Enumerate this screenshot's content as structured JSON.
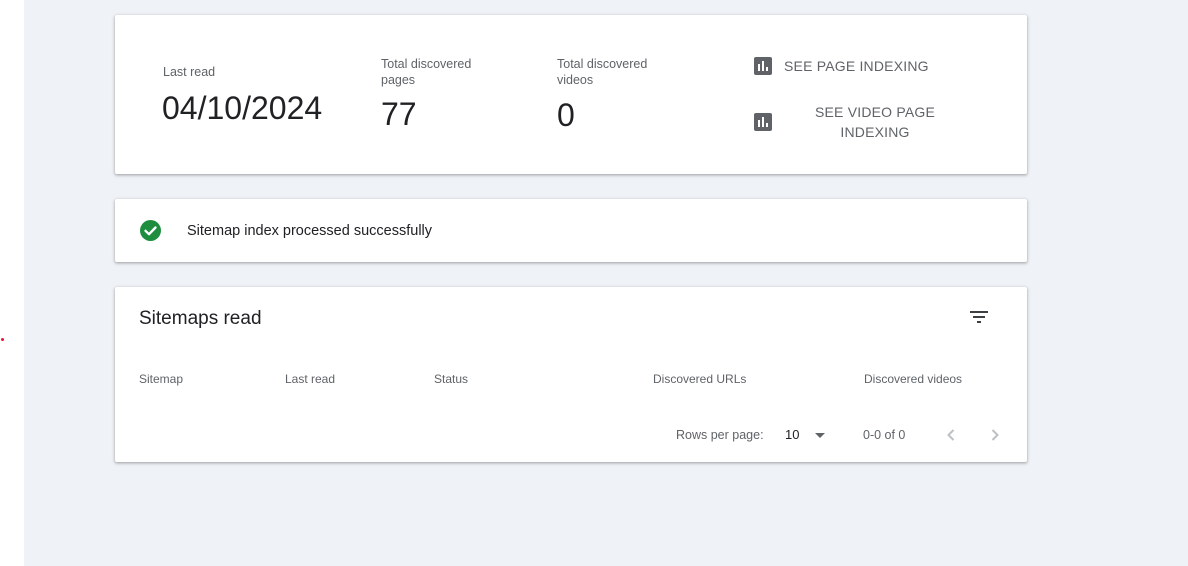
{
  "summary": {
    "last_read_label": "Last read",
    "last_read_value": "04/10/2024",
    "pages_label_line1": "Total discovered",
    "pages_label_line2": "pages",
    "pages_value": "77",
    "videos_label_line1": "Total discovered",
    "videos_label_line2": "videos",
    "videos_value": "0",
    "see_page_indexing": "SEE PAGE INDEXING",
    "see_video_indexing_line1": "SEE VIDEO PAGE",
    "see_video_indexing_line2": "INDEXING",
    "icon": "bar-chart-icon"
  },
  "status": {
    "text": "Sitemap index processed successfully",
    "icon": "check-circle-icon",
    "color": "#1e8e3e"
  },
  "table": {
    "title": "Sitemaps read",
    "filter_icon": "filter-icon",
    "columns": [
      "Sitemap",
      "Last read",
      "Status",
      "Discovered URLs",
      "Discovered videos"
    ],
    "rows": [],
    "pagination": {
      "rows_per_page_label": "Rows per page:",
      "rows_per_page_value": "10",
      "range": "0-0 of 0",
      "prev_icon": "chevron-left-icon",
      "next_icon": "chevron-right-icon"
    }
  },
  "colors": {
    "background": "#eff2f6",
    "card": "#ffffff",
    "text_primary": "#202124",
    "text_secondary": "#5f6368",
    "success": "#1e8e3e"
  }
}
